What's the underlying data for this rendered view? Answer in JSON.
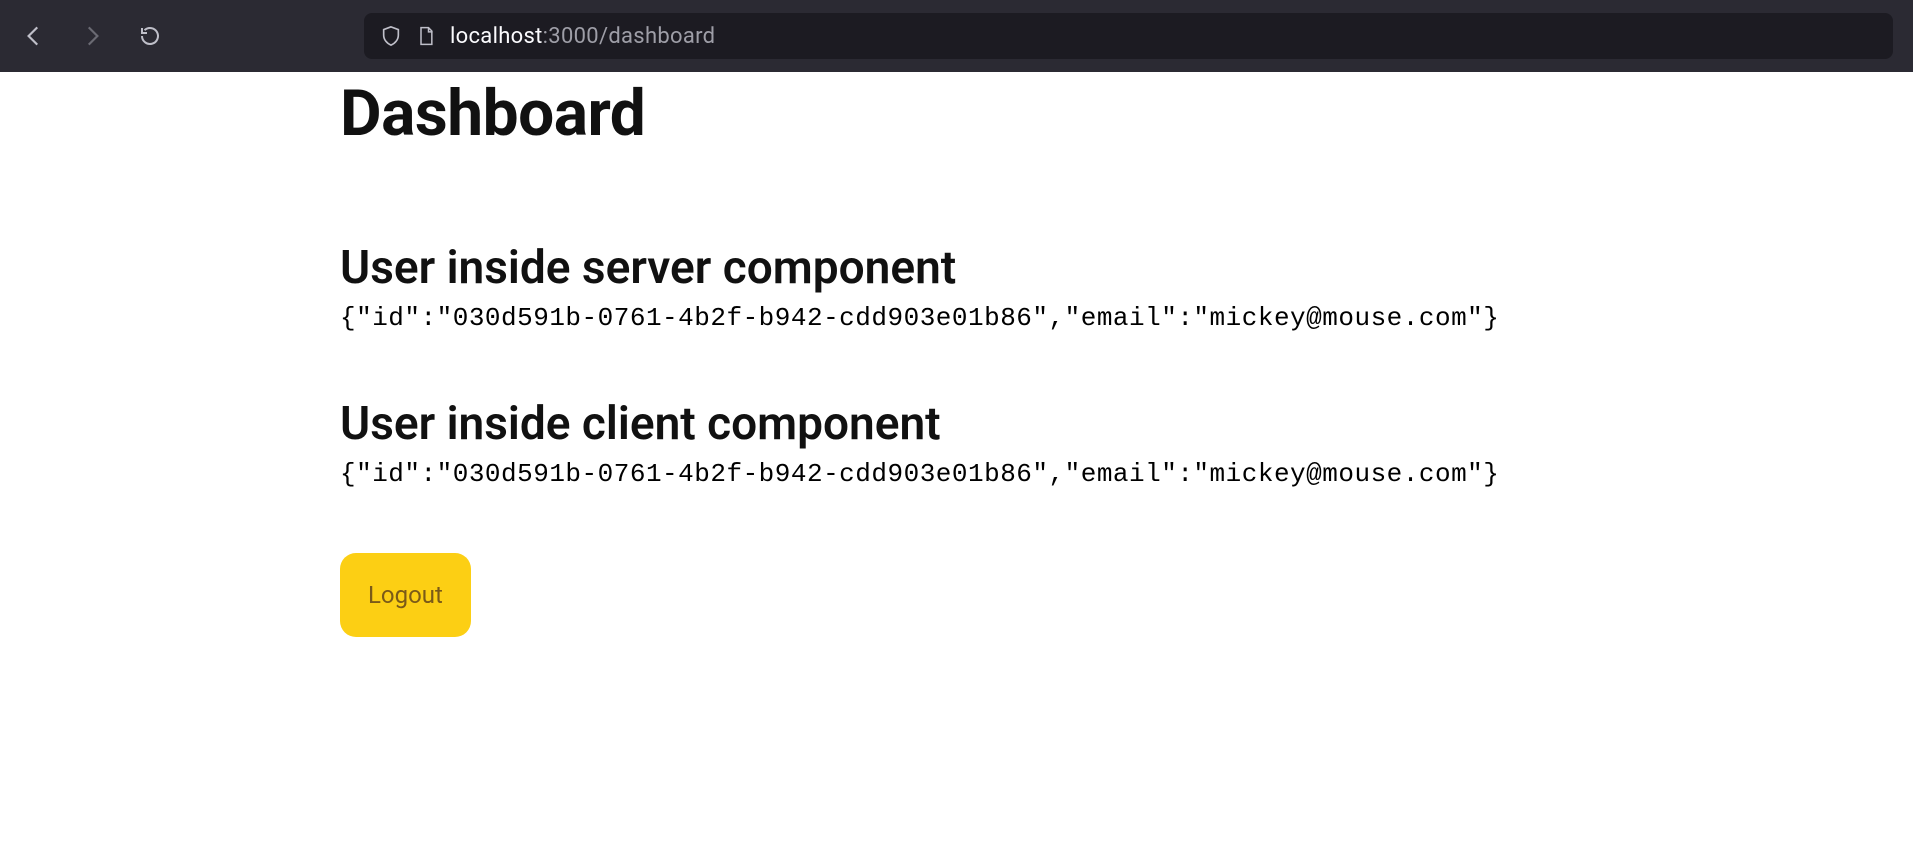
{
  "browser": {
    "url_host": "localhost",
    "url_port_path": ":3000/dashboard"
  },
  "page": {
    "title": "Dashboard",
    "server_section": {
      "heading": "User inside server component",
      "json": "{\"id\":\"030d591b-0761-4b2f-b942-cdd903e01b86\",\"email\":\"mickey@mouse.com\"}"
    },
    "client_section": {
      "heading": "User inside client component",
      "json": "{\"id\":\"030d591b-0761-4b2f-b942-cdd903e01b86\",\"email\":\"mickey@mouse.com\"}"
    },
    "logout_label": "Logout"
  }
}
